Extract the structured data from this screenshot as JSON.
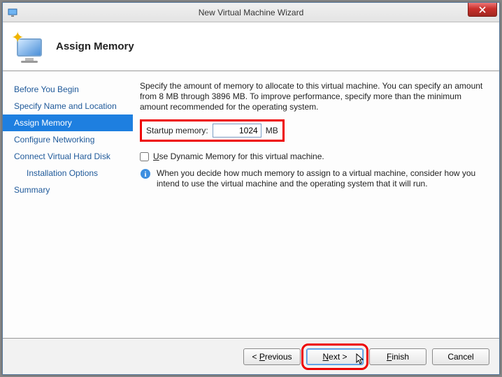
{
  "window": {
    "title": "New Virtual Machine Wizard"
  },
  "header": {
    "title": "Assign Memory"
  },
  "sidebar": {
    "items": [
      {
        "label": "Before You Begin"
      },
      {
        "label": "Specify Name and Location"
      },
      {
        "label": "Assign Memory"
      },
      {
        "label": "Configure Networking"
      },
      {
        "label": "Connect Virtual Hard Disk"
      },
      {
        "label": "Installation Options"
      },
      {
        "label": "Summary"
      }
    ]
  },
  "main": {
    "description": "Specify the amount of memory to allocate to this virtual machine. You can specify an amount from 8 MB through 3896 MB. To improve performance, specify more than the minimum amount recommended for the operating system.",
    "startup_label": "Startup memory:",
    "startup_value": "1024",
    "mb_suffix": "MB",
    "dynamic_label": "Use Dynamic Memory for this virtual machine.",
    "info_text": "When you decide how much memory to assign to a virtual machine, consider how you intend to use the virtual machine and the operating system that it will run."
  },
  "footer": {
    "previous": "< Previous",
    "next": "Next >",
    "finish": "Finish",
    "cancel": "Cancel"
  }
}
